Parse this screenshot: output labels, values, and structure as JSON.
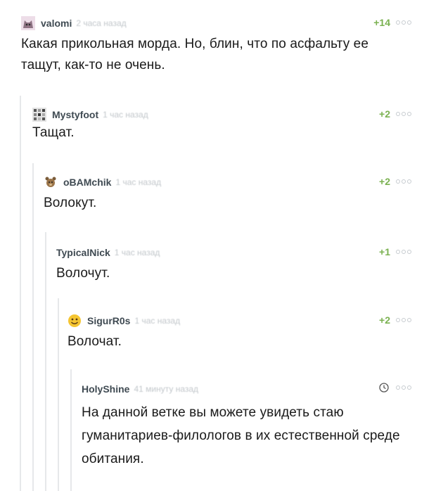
{
  "comments": [
    {
      "username": "valomi",
      "time": "2 часа назад",
      "score": "+14",
      "text": "Какая прикольная морда. Но, блин, что по асфальту ее тащут, как-то не очень.",
      "avatar": "cat-avatar"
    },
    {
      "username": "Mystyfoot",
      "time": "1 час назад",
      "score": "+2",
      "text": "Тащат.",
      "avatar": "pixel-avatar"
    },
    {
      "username": "oBAMchik",
      "time": "1 час назад",
      "score": "+2",
      "text": "Волокут.",
      "avatar": "bear-avatar"
    },
    {
      "username": "TypicalNick",
      "time": "1 час назад",
      "score": "+1",
      "text": "Волочут."
    },
    {
      "username": "SigurR0s",
      "time": "1 час назад",
      "score": "+2",
      "text": "Волочат.",
      "avatar": "smiley-avatar"
    },
    {
      "username": "HolyShine",
      "time": "41 минуту назад",
      "score_icon": "clock-icon",
      "text": "На данной ветке вы можете увидеть стаю гуманитариев-филологов в их естественной среде обитания."
    }
  ],
  "colors": {
    "score_green": "#7ab150",
    "username": "#3f4a52",
    "timestamp": "#c2c7cb",
    "thread_line": "#e6e8ea"
  }
}
